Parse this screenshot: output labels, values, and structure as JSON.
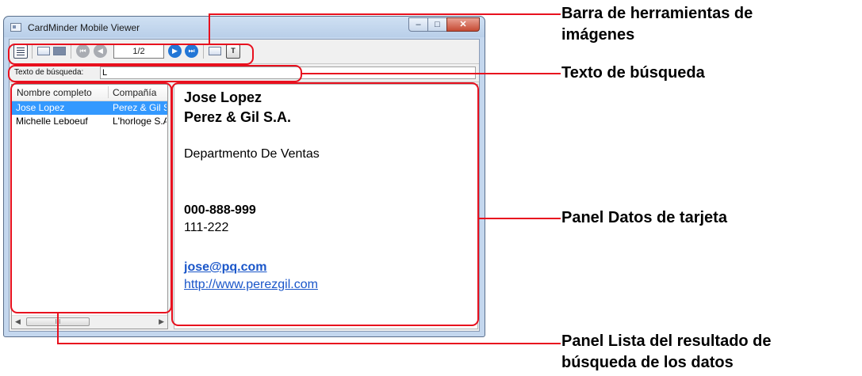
{
  "window": {
    "title": "CardMinder Mobile Viewer",
    "controls": {
      "minimize": "–",
      "maximize": "□",
      "close": "✕"
    }
  },
  "toolbar": {
    "page_indicator": "1/2",
    "icons": [
      "list-view-icon",
      "card-front-icon",
      "card-back-icon",
      "first-page-icon",
      "previous-page-icon",
      "next-page-icon",
      "last-page-icon",
      "card-image-icon",
      "text-icon"
    ],
    "text_button": "T"
  },
  "search": {
    "label": "Texto de búsqueda:",
    "value": "L"
  },
  "results_list": {
    "columns": [
      "Nombre completo",
      "Compañía"
    ],
    "rows": [
      {
        "name": "Jose Lopez",
        "company": "Perez & Gil S.A.",
        "selected": true
      },
      {
        "name": "Michelle Leboeuf",
        "company": "L'horloge S.A.",
        "selected": false
      }
    ],
    "scrollbar": {
      "left": "◀",
      "thumb": "III",
      "right": "▶"
    }
  },
  "card": {
    "name": "Jose Lopez",
    "company": "Perez & Gil S.A.",
    "department": "Departmento De Ventas",
    "phone_1": "000-888-999",
    "phone_2": "111-222",
    "email": "jose@pq.com",
    "url": "http://www.perezgil.com"
  },
  "callouts": {
    "toolbar": [
      "Barra de herramientas de",
      "imágenes"
    ],
    "search": [
      "Texto de búsqueda"
    ],
    "card": [
      "Panel Datos de tarjeta"
    ],
    "list": [
      "Panel Lista del resultado de",
      "búsqueda de los datos"
    ]
  },
  "colors": {
    "highlight": "#e8101e",
    "selection": "#3399ff",
    "link": "#1a56c9"
  }
}
